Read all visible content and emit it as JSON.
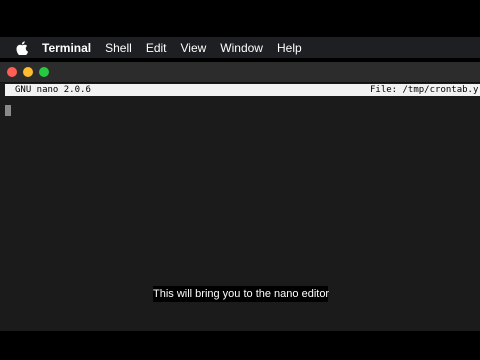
{
  "menubar": {
    "apple_icon": "apple-logo-icon",
    "app_name": "Terminal",
    "items": [
      "Shell",
      "Edit",
      "View",
      "Window",
      "Help"
    ]
  },
  "window": {
    "traffic_lights": {
      "close_color": "#ff5f57",
      "minimize_color": "#febc2e",
      "zoom_color": "#28c840"
    }
  },
  "nano": {
    "version": "GNU nano 2.0.6",
    "file": "File: /tmp/crontab.y"
  },
  "caption": {
    "text": "This will bring you to the nano editor"
  }
}
